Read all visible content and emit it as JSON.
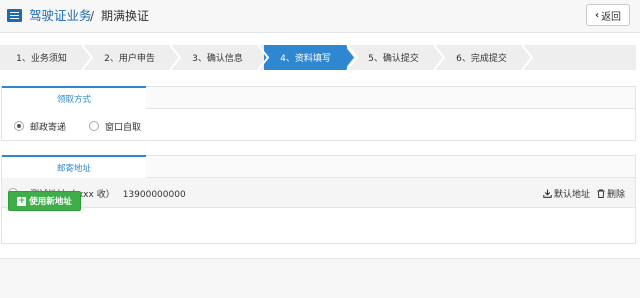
{
  "header": {
    "title": "驾驶证业务",
    "separator": "/",
    "subtitle": "期满换证",
    "back_label": "返回"
  },
  "steps": [
    {
      "label": "1、业务须知",
      "active": false
    },
    {
      "label": "2、用户申告",
      "active": false
    },
    {
      "label": "3、确认信息",
      "active": false
    },
    {
      "label": "4、资料填写",
      "active": true
    },
    {
      "label": "5、确认提交",
      "active": false
    },
    {
      "label": "6、完成提交",
      "active": false
    }
  ],
  "pickup": {
    "tab_label": "领取方式",
    "options": [
      {
        "label": "邮政寄递",
        "checked": true
      },
      {
        "label": "窗口自取",
        "checked": false
      }
    ]
  },
  "mailing": {
    "tab_label": "邮寄地址",
    "address": {
      "name": "测试地址（ xxx 收）",
      "phone": "13900000000",
      "checked": true
    },
    "default_label": "默认地址",
    "delete_label": "删除",
    "new_address_label": "使用新地址"
  },
  "colors": {
    "accent": "#2e87d0",
    "brand": "#1f6bb3",
    "success": "#3fae49"
  }
}
